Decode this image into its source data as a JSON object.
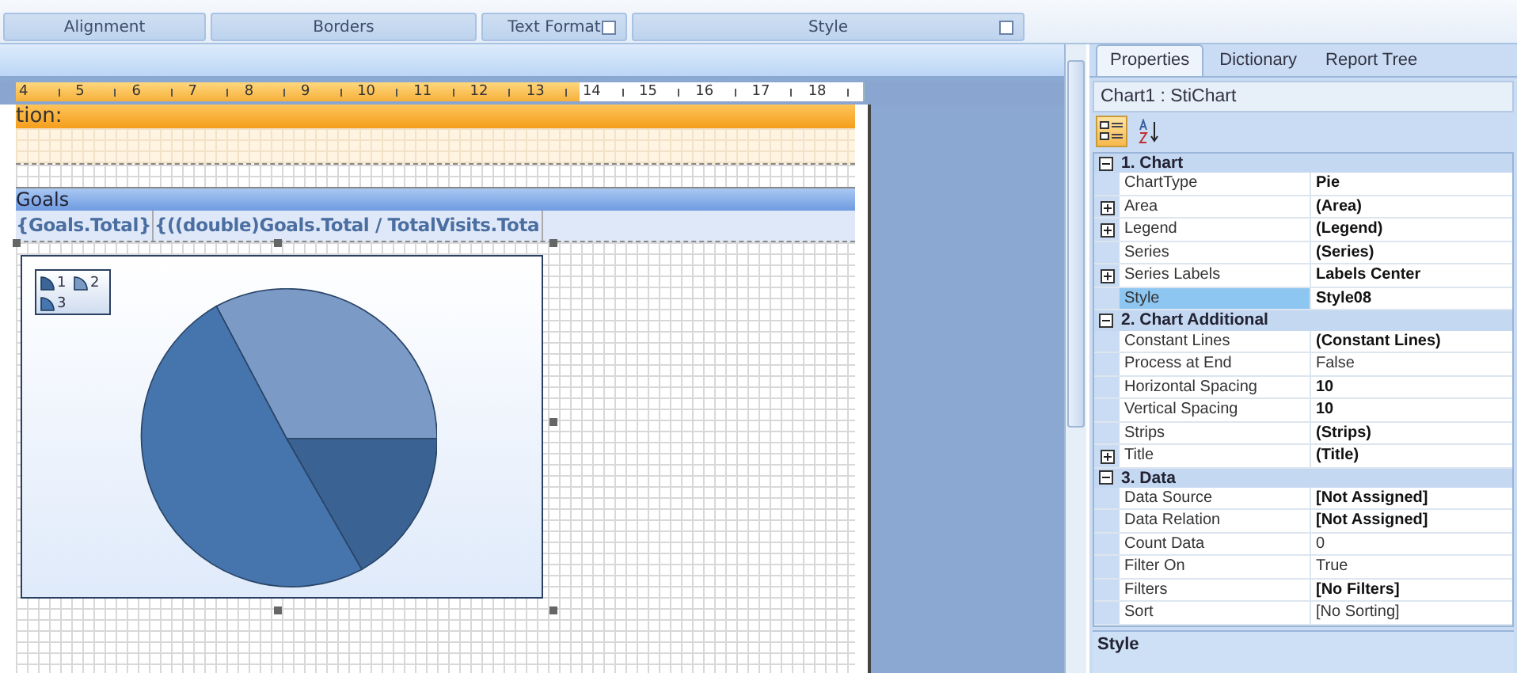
{
  "ribbon_groups": [
    {
      "label": "Alignment",
      "launcher": false
    },
    {
      "label": "Borders",
      "launcher": false
    },
    {
      "label": "Text Format",
      "launcher": true
    },
    {
      "label": "Style",
      "launcher": true
    }
  ],
  "ruler": [
    {
      "label": "4",
      "selected": true
    },
    {
      "label": "5",
      "selected": true
    },
    {
      "label": "6",
      "selected": true
    },
    {
      "label": "7",
      "selected": true
    },
    {
      "label": "8",
      "selected": true
    },
    {
      "label": "9",
      "selected": true
    },
    {
      "label": "10",
      "selected": true
    },
    {
      "label": "11",
      "selected": true
    },
    {
      "label": "12",
      "selected": true
    },
    {
      "label": "13",
      "selected": true
    },
    {
      "label": "14",
      "selected": false
    },
    {
      "label": "15",
      "selected": false
    },
    {
      "label": "16",
      "selected": false
    },
    {
      "label": "17",
      "selected": false
    },
    {
      "label": "18",
      "selected": false
    }
  ],
  "bands": [
    {
      "kind": "header",
      "title": "tion:"
    },
    {
      "kind": "group",
      "title": "Goals"
    }
  ],
  "data_cells": [
    "{Goals.Total}",
    "{((double)Goals.Total / TotalVisits.Tota"
  ],
  "chart": {
    "legend": [
      "1",
      "2",
      "3"
    ]
  },
  "panel": {
    "tabs": [
      {
        "label": "Properties",
        "selected": true
      },
      {
        "label": "Dictionary",
        "selected": false
      },
      {
        "label": "Report Tree",
        "selected": false
      }
    ],
    "component": "Chart1 : StiChart",
    "sort_buttons": [
      {
        "kind": "categorized",
        "selected": true
      },
      {
        "kind": "alphabetical",
        "selected": false
      }
    ],
    "rows": [
      {
        "kind": "category",
        "name": "1. Chart",
        "expanded": true
      },
      {
        "kind": "property",
        "name": "ChartType",
        "value": "Pie",
        "bold": true,
        "expandable": false,
        "selected": false
      },
      {
        "kind": "property",
        "name": "Area",
        "value": "(Area)",
        "bold": true,
        "expandable": true,
        "selected": false
      },
      {
        "kind": "property",
        "name": "Legend",
        "value": "(Legend)",
        "bold": true,
        "expandable": true,
        "selected": false
      },
      {
        "kind": "property",
        "name": "Series",
        "value": "(Series)",
        "bold": true,
        "expandable": false,
        "selected": false
      },
      {
        "kind": "property",
        "name": "Series Labels",
        "value": "Labels Center",
        "bold": true,
        "expandable": true,
        "selected": false
      },
      {
        "kind": "property",
        "name": "Style",
        "value": "Style08",
        "bold": true,
        "expandable": false,
        "selected": true
      },
      {
        "kind": "category",
        "name": "2. Chart Additional",
        "expanded": true
      },
      {
        "kind": "property",
        "name": "Constant Lines",
        "value": "(Constant Lines)",
        "bold": true,
        "expandable": false,
        "selected": false
      },
      {
        "kind": "property",
        "name": "Process at End",
        "value": "False",
        "bold": false,
        "expandable": false,
        "selected": false
      },
      {
        "kind": "property",
        "name": "Horizontal Spacing",
        "value": "10",
        "bold": true,
        "expandable": false,
        "selected": false
      },
      {
        "kind": "property",
        "name": "Vertical Spacing",
        "value": "10",
        "bold": true,
        "expandable": false,
        "selected": false
      },
      {
        "kind": "property",
        "name": "Strips",
        "value": "(Strips)",
        "bold": true,
        "expandable": false,
        "selected": false
      },
      {
        "kind": "property",
        "name": "Title",
        "value": "(Title)",
        "bold": true,
        "expandable": true,
        "selected": false
      },
      {
        "kind": "category",
        "name": "3. Data",
        "expanded": true
      },
      {
        "kind": "property",
        "name": "Data Source",
        "value": "[Not Assigned]",
        "bold": true,
        "expandable": false,
        "selected": false
      },
      {
        "kind": "property",
        "name": "Data Relation",
        "value": "[Not Assigned]",
        "bold": true,
        "expandable": false,
        "selected": false
      },
      {
        "kind": "property",
        "name": "Count Data",
        "value": "0",
        "bold": false,
        "expandable": false,
        "selected": false
      },
      {
        "kind": "property",
        "name": "Filter On",
        "value": "True",
        "bold": false,
        "expandable": false,
        "selected": false
      },
      {
        "kind": "property",
        "name": "Filters",
        "value": "[No Filters]",
        "bold": true,
        "expandable": false,
        "selected": false
      },
      {
        "kind": "property",
        "name": "Sort",
        "value": "[No Sorting]",
        "bold": false,
        "expandable": false,
        "selected": false
      }
    ],
    "description": "Style"
  }
}
